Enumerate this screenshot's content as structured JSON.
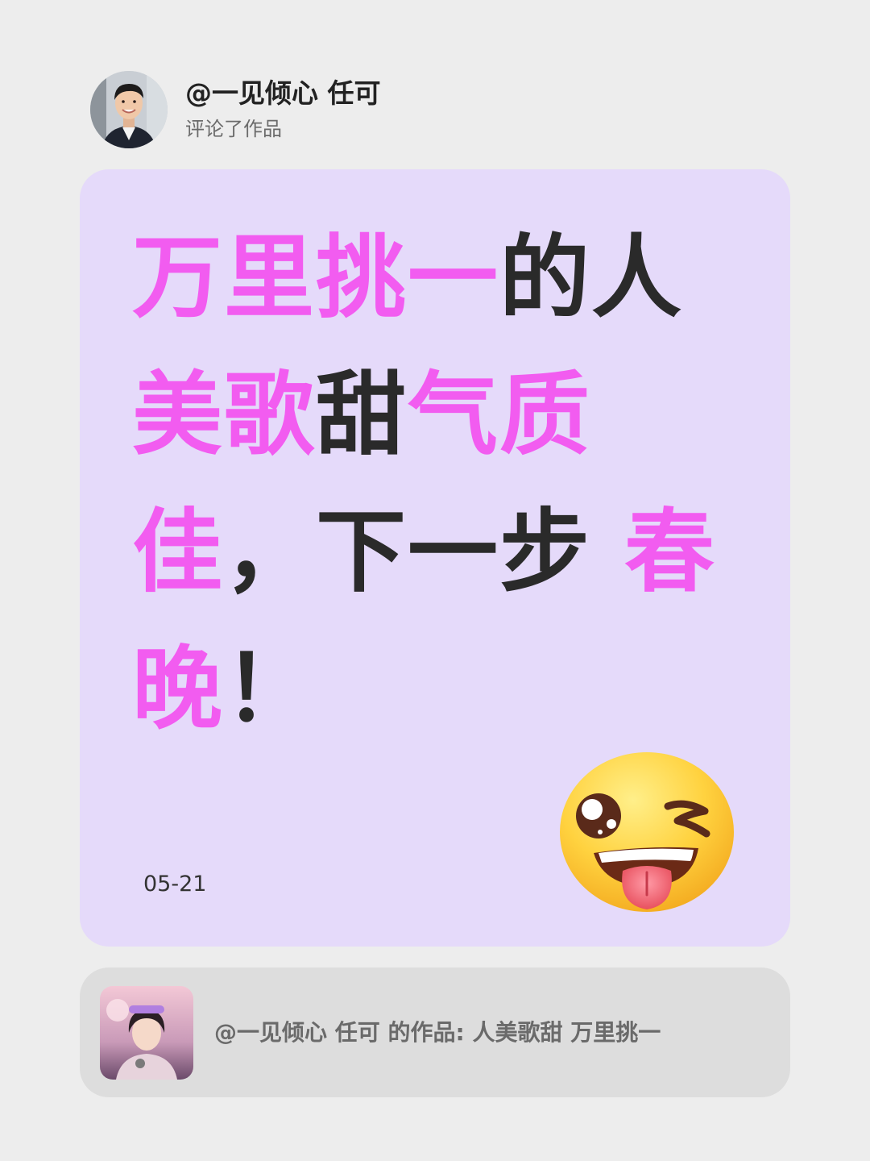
{
  "header": {
    "username": "@一见倾心 任可",
    "action": "评论了作品"
  },
  "comment": {
    "lines": [
      [
        {
          "text": "万里挑一",
          "highlight": true
        },
        {
          "text": "的人",
          "highlight": false
        }
      ],
      [
        {
          "text": "美歌",
          "highlight": true
        },
        {
          "text": "甜",
          "highlight": false
        },
        {
          "text": "气质",
          "highlight": true
        }
      ],
      [
        {
          "text": "佳",
          "highlight": true
        },
        {
          "text": "，下一步 ",
          "highlight": false
        },
        {
          "text": "春",
          "highlight": true
        }
      ],
      [
        {
          "text": "晚",
          "highlight": true
        },
        {
          "text": "！",
          "highlight": false
        }
      ]
    ],
    "date": "05-21",
    "emoji": "winking-face-with-tongue-icon",
    "highlight_color": "#f25cf0",
    "text_color": "#2a2a2a"
  },
  "reference": {
    "text": "@一见倾心 任可 的作品: 人美歌甜 万里挑一"
  },
  "colors": {
    "background": "#ededed",
    "card": "#e5dafa",
    "reference_bar": "#dddddd"
  }
}
